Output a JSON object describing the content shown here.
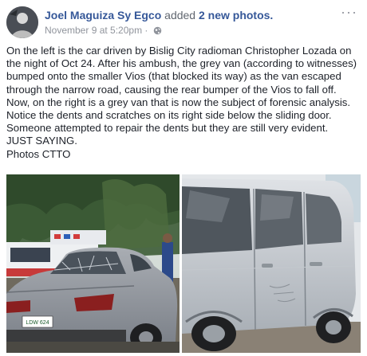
{
  "post": {
    "author": "Joel Maguiza Sy Egco",
    "action": "added",
    "photos_link": "2 new photos.",
    "timestamp": "November 9 at 5:20pm",
    "separator": "·",
    "more_label": "···",
    "lines": [
      "On the left is the car driven by Bislig City radioman Christopher Lozada on",
      "the night of Oct 24. After his ambush, the grey van (according to witnesses)",
      "bumped onto the smaller Vios (that blocked its way) as the van escaped",
      "through the narrow road, causing the rear bumper of the Vios to fall off.",
      "Now, on the right is a grey van that is now the subject of forensic analysis.",
      "Notice the dents and scratches on its right side below the sliding door.",
      "Someone attempted to repair the dents but they are still very evident.",
      "JUST SAYING.",
      "Photos CTTO"
    ],
    "photos": {
      "left": {
        "plate_text": "LDW 624"
      }
    }
  },
  "colors": {
    "link": "#365899",
    "meta": "#90949c",
    "text": "#1d2129"
  },
  "icons": [
    "avatar",
    "globe-icon",
    "more-options-icon"
  ]
}
